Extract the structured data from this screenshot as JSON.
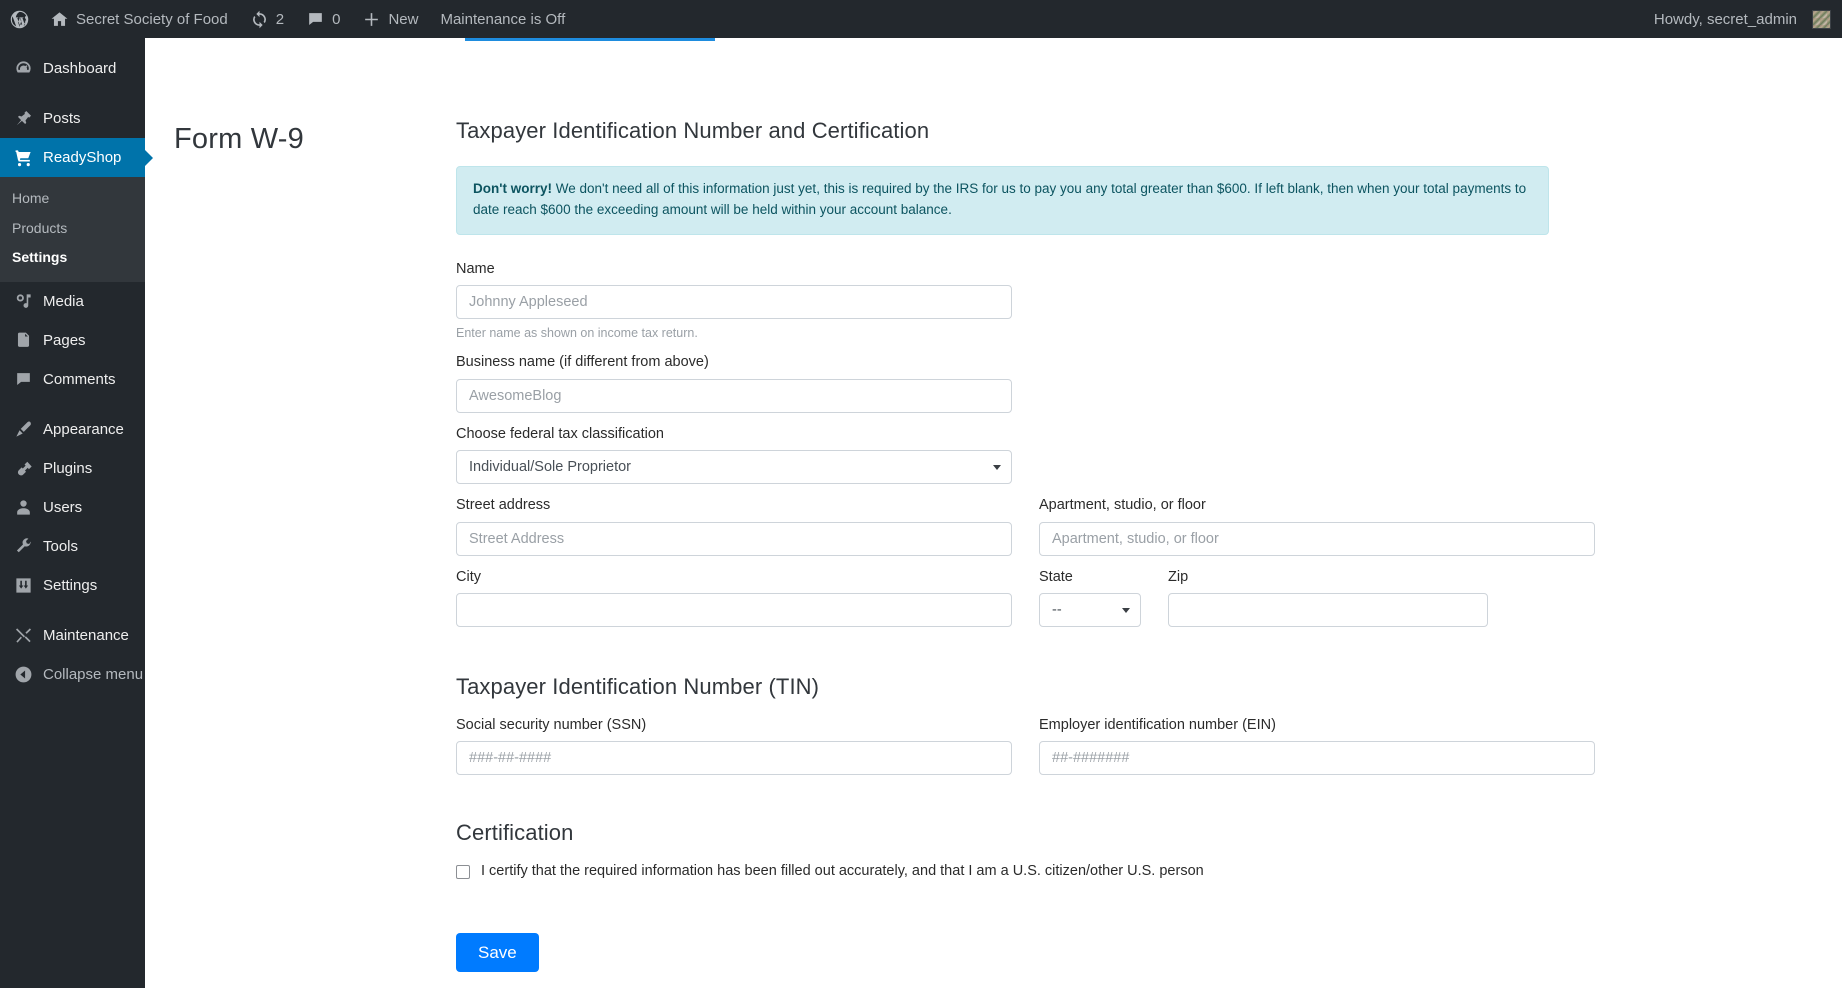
{
  "adminbar": {
    "logo_icon": "wordpress-logo-icon",
    "site_name": "Secret Society of Food",
    "site_icon": "home-icon",
    "updates_icon": "updates-icon",
    "updates_count": "2",
    "comments_icon": "comment-bubble-icon",
    "comments_count": "0",
    "new_icon": "plus-icon",
    "new_label": "New",
    "maintenance_label": "Maintenance is Off",
    "howdy": "Howdy, secret_admin",
    "avatar_icon": "user-avatar"
  },
  "sidebar": {
    "items": [
      {
        "label": "Dashboard",
        "icon": "dashboard-icon",
        "current": false
      },
      {
        "label": "Posts",
        "icon": "pin-icon",
        "current": false
      },
      {
        "label": "ReadyShop",
        "icon": "cart-icon",
        "current": true
      },
      {
        "label": "Media",
        "icon": "media-icon",
        "current": false
      },
      {
        "label": "Pages",
        "icon": "pages-icon",
        "current": false
      },
      {
        "label": "Comments",
        "icon": "comment-icon",
        "current": false
      },
      {
        "label": "Appearance",
        "icon": "paintbrush-icon",
        "current": false
      },
      {
        "label": "Plugins",
        "icon": "plug-icon",
        "current": false
      },
      {
        "label": "Users",
        "icon": "user-icon",
        "current": false
      },
      {
        "label": "Tools",
        "icon": "wrench-icon",
        "current": false
      },
      {
        "label": "Settings",
        "icon": "sliders-icon",
        "current": false
      },
      {
        "label": "Maintenance",
        "icon": "tools-cross-icon",
        "current": false
      }
    ],
    "submenu": [
      {
        "label": "Home",
        "current": false
      },
      {
        "label": "Products",
        "current": false
      },
      {
        "label": "Settings",
        "current": true
      }
    ],
    "collapse": {
      "label": "Collapse menu",
      "icon": "collapse-arrow-icon"
    }
  },
  "page": {
    "title": "Form W-9",
    "section_title": "Taxpayer Identification Number and Certification",
    "notice": {
      "strong": "Don't worry!",
      "text": " We don't need all of this information just yet, this is required by the IRS for us to pay you any total greater than $600. If left blank, then when your total payments to date reach $600 the exceeding amount will be held within your account balance."
    },
    "fields": {
      "name": {
        "label": "Name",
        "placeholder": "Johnny Appleseed",
        "value": "",
        "help": "Enter name as shown on income tax return."
      },
      "business_name": {
        "label": "Business name (if different from above)",
        "placeholder": "AwesomeBlog",
        "value": ""
      },
      "tax_classification": {
        "label": "Choose federal tax classification",
        "selected": "Individual/Sole Proprietor"
      },
      "street": {
        "label": "Street address",
        "placeholder": "Street Address",
        "value": ""
      },
      "apartment": {
        "label": "Apartment, studio, or floor",
        "placeholder": "Apartment, studio, or floor",
        "value": ""
      },
      "city": {
        "label": "City",
        "placeholder": "",
        "value": ""
      },
      "state": {
        "label": "State",
        "selected": "--"
      },
      "zip": {
        "label": "Zip",
        "placeholder": "",
        "value": ""
      },
      "ssn": {
        "label": "Social security number (SSN)",
        "placeholder": "###-##-####",
        "value": ""
      },
      "ein": {
        "label": "Employer identification number (EIN)",
        "placeholder": "##-#######",
        "value": ""
      }
    },
    "tin_title": "Taxpayer Identification Number (TIN)",
    "certification_title": "Certification",
    "certification_label": "I certify that the required information has been filled out accurately, and that I am a U.S. citizen/other U.S. person",
    "certification_checked": false,
    "save_label": "Save"
  },
  "colors": {
    "admin_dark": "#23282d",
    "submenu_dark": "#32373c",
    "current_blue": "#0073aa",
    "tab_blue": "#1e8cde",
    "notice_bg": "#d1ecf1",
    "notice_border": "#bee5eb",
    "notice_text": "#0c5460",
    "save_blue": "#007bff"
  }
}
